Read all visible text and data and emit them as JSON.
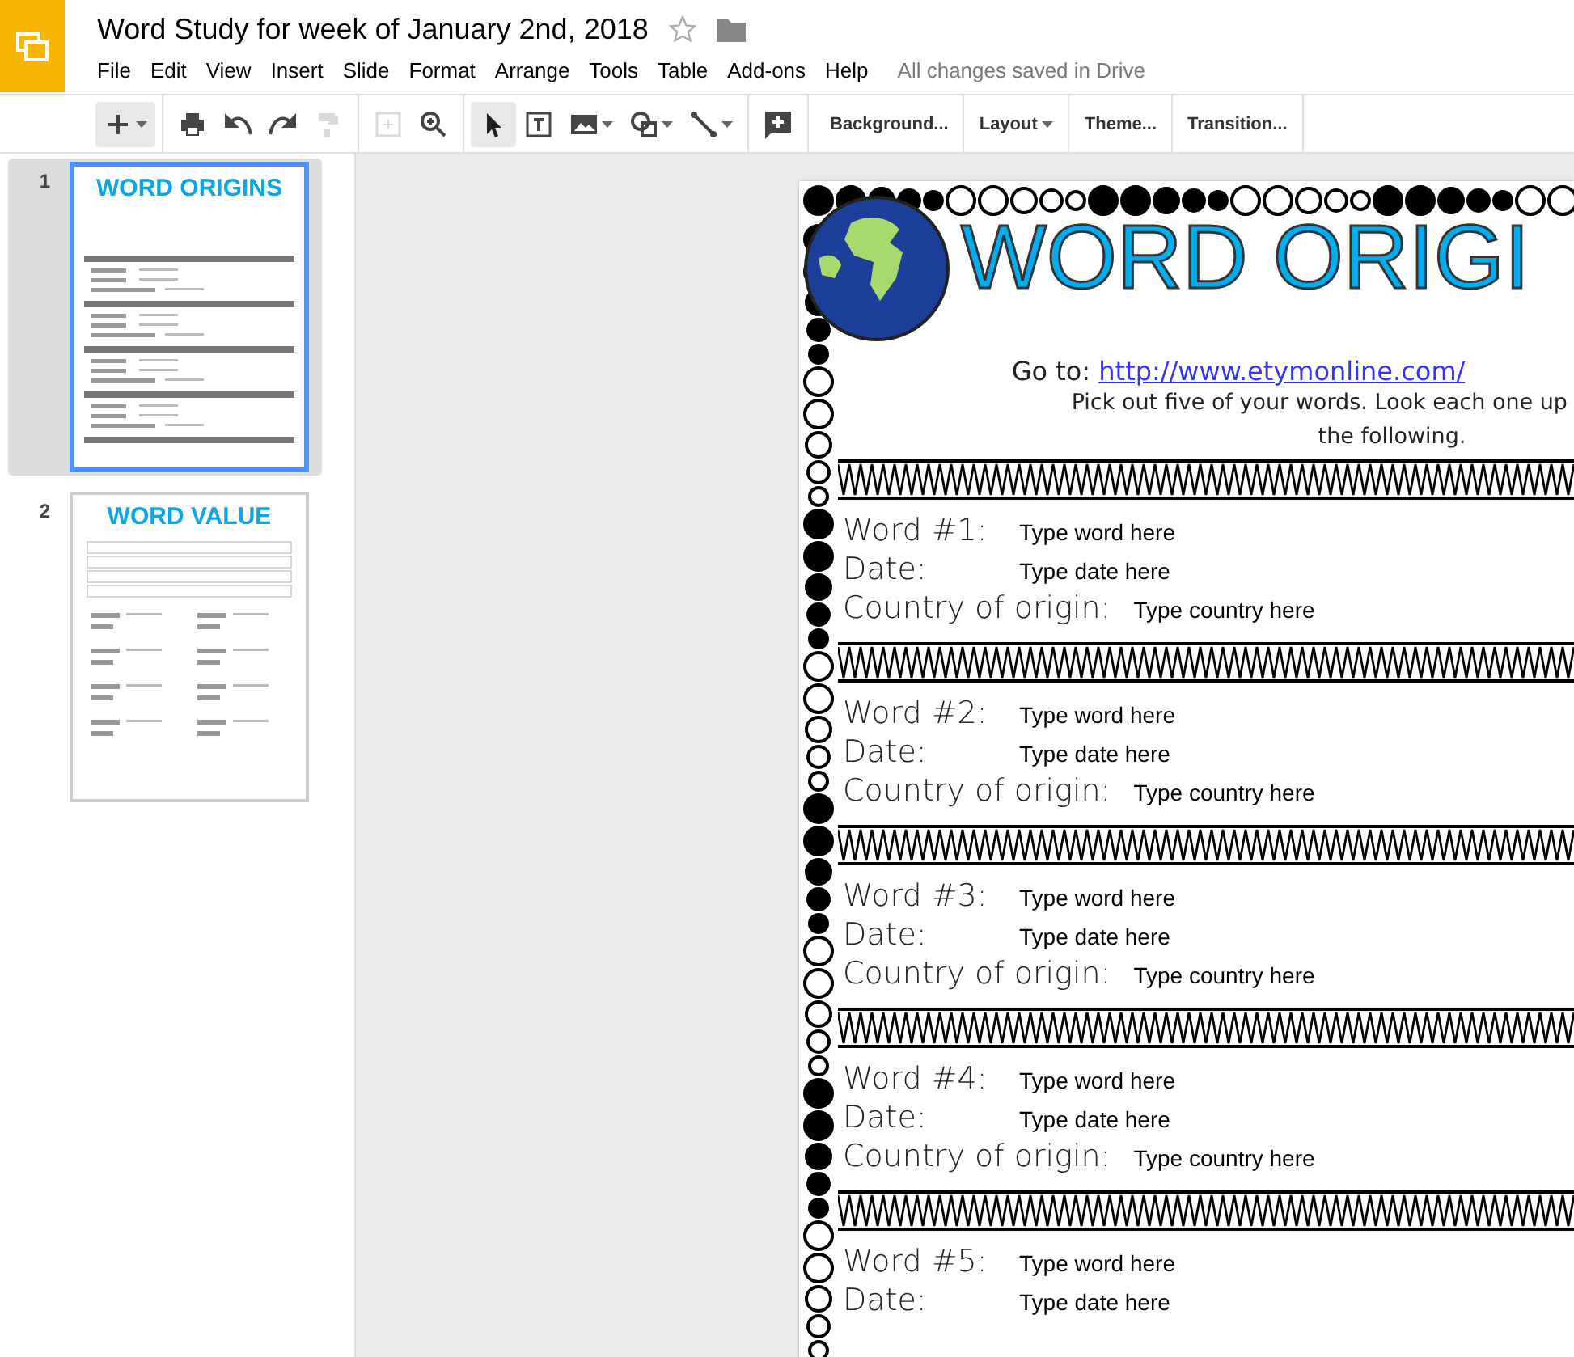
{
  "window": {
    "title": "Word Study for week of January 2nd, 2018",
    "save_status": "All changes saved in Drive",
    "starred": false
  },
  "menu": [
    "File",
    "Edit",
    "View",
    "Insert",
    "Slide",
    "Format",
    "Arrange",
    "Tools",
    "Table",
    "Add-ons",
    "Help"
  ],
  "toolbar": {
    "tools": [
      {
        "kind": "new",
        "dropdown": true,
        "selected": true,
        "disabled": false
      },
      {
        "kind": "print",
        "dropdown": false,
        "selected": false,
        "disabled": false
      },
      {
        "kind": "undo",
        "dropdown": false,
        "selected": false,
        "disabled": false
      },
      {
        "kind": "redo",
        "dropdown": false,
        "selected": false,
        "disabled": false
      },
      {
        "kind": "paint",
        "dropdown": false,
        "selected": false,
        "disabled": true
      },
      {
        "kind": "fit",
        "dropdown": false,
        "selected": false,
        "disabled": true
      },
      {
        "kind": "zoom",
        "dropdown": false,
        "selected": false,
        "disabled": false
      },
      {
        "kind": "select",
        "dropdown": false,
        "selected": true,
        "disabled": false
      },
      {
        "kind": "textbox",
        "dropdown": false,
        "selected": false,
        "disabled": false
      },
      {
        "kind": "image",
        "dropdown": true,
        "selected": false,
        "disabled": false
      },
      {
        "kind": "shape",
        "dropdown": true,
        "selected": false,
        "disabled": false
      },
      {
        "kind": "line",
        "dropdown": true,
        "selected": false,
        "disabled": false
      },
      {
        "kind": "comment",
        "dropdown": false,
        "selected": false,
        "disabled": false
      }
    ],
    "buttons": [
      {
        "label": "Background...",
        "dropdown": false
      },
      {
        "label": "Layout",
        "dropdown": true
      },
      {
        "label": "Theme...",
        "dropdown": false
      },
      {
        "label": "Transition...",
        "dropdown": false
      }
    ]
  },
  "slides": [
    {
      "number": "1",
      "title": "WORD ORIGINS",
      "selected": true,
      "kind": "origins"
    },
    {
      "number": "2",
      "title": "WORD VALUE",
      "selected": false,
      "kind": "value"
    }
  ],
  "slide": {
    "title": "WORD ORIGI",
    "goto_label": "Go to:",
    "link": "http://www.etymonline.com/",
    "instructions": [
      "Pick out five of your words. Look each one up",
      "the following."
    ],
    "entries": [
      {
        "rows": [
          {
            "label": "Word #1:",
            "value": "Type word here"
          },
          {
            "label": "Date:",
            "value": "Type date here"
          },
          {
            "label": "Country of origin:",
            "value": "Type country here"
          }
        ]
      },
      {
        "rows": [
          {
            "label": "Word #2:",
            "value": "Type word here"
          },
          {
            "label": "Date:",
            "value": "Type date here"
          },
          {
            "label": "Country of origin:",
            "value": "Type country here"
          }
        ]
      },
      {
        "rows": [
          {
            "label": "Word #3:",
            "value": "Type word here"
          },
          {
            "label": "Date:",
            "value": "Type date here"
          },
          {
            "label": "Country of origin:",
            "value": "Type country here"
          }
        ]
      },
      {
        "rows": [
          {
            "label": "Word #4:",
            "value": "Type word here"
          },
          {
            "label": "Date:",
            "value": "Type date here"
          },
          {
            "label": "Country of origin:",
            "value": "Type country here"
          }
        ]
      },
      {
        "rows": [
          {
            "label": "Word #5:",
            "value": "Type word here"
          },
          {
            "label": "Date:",
            "value": "Type date here"
          }
        ]
      }
    ]
  }
}
